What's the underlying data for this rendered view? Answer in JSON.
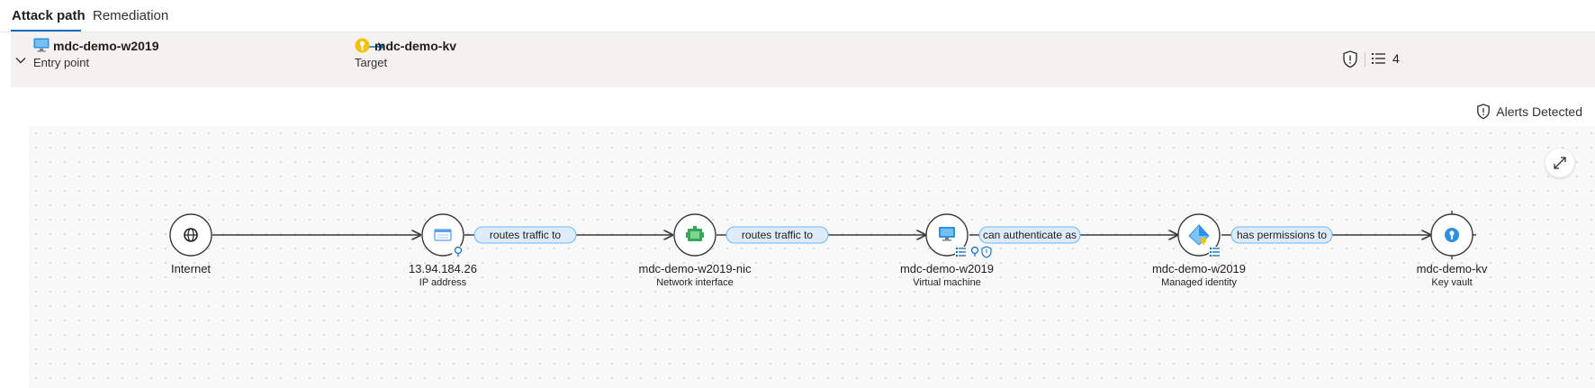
{
  "tabs": [
    {
      "label": "Attack path",
      "active": true
    },
    {
      "label": "Remediation",
      "active": false
    }
  ],
  "summary": {
    "entry_name": "mdc-demo-w2019",
    "entry_sub": "Entry point",
    "target_name": "mdc-demo-kv",
    "target_sub": "Target",
    "recommendation_count": "4"
  },
  "legend": {
    "alerts_detected": "Alerts Detected"
  },
  "graph": {
    "nodes": [
      {
        "label": "Internet",
        "type": "",
        "icon": "globe-icon"
      },
      {
        "label": "13.94.184.26",
        "type": "IP address",
        "icon": "public-ip-icon",
        "badges": [
          "insight-icon"
        ]
      },
      {
        "label": "mdc-demo-w2019-nic",
        "type": "Network interface",
        "icon": "network-interface-icon"
      },
      {
        "label": "mdc-demo-w2019",
        "type": "Virtual machine",
        "icon": "virtual-machine-icon",
        "badges": [
          "recommendations-icon",
          "insight-icon",
          "alert-shield-icon"
        ]
      },
      {
        "label": "mdc-demo-w2019",
        "type": "Managed identity",
        "icon": "managed-identity-icon",
        "badges": [
          "recommendations-icon"
        ]
      },
      {
        "label": "mdc-demo-kv",
        "type": "Key vault",
        "icon": "key-vault-icon"
      }
    ],
    "edges": [
      {
        "label": ""
      },
      {
        "label": "routes traffic to"
      },
      {
        "label": "routes traffic to"
      },
      {
        "label": "can authenticate as"
      },
      {
        "label": "has permissions to"
      }
    ]
  },
  "colors": {
    "accent": "#0f6cbd",
    "edge_label_bg": "#deecf9",
    "edge_label_border": "#6cb8f6",
    "line": "#3b3a39",
    "canvas_bg": "#f8f8f8"
  }
}
